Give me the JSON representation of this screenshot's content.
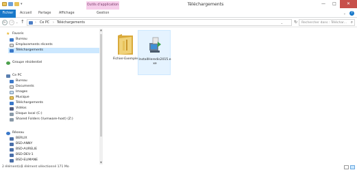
{
  "window": {
    "title": "Téléchargements",
    "contextual_tab": "Outils d'application",
    "minimize": "—",
    "maximize": "□",
    "close": "✕"
  },
  "ribbon": {
    "tabs": [
      "Fichier",
      "Accueil",
      "Partage",
      "Affichage",
      "Gestion"
    ],
    "collapse_chevron": "⌄",
    "help": "?"
  },
  "address": {
    "back": "←",
    "forward": "→",
    "history_dropdown": "⌄",
    "up": "↑",
    "crumbs": [
      "Ce PC",
      "Téléchargements"
    ],
    "separator": "›",
    "dropdown": "⌄",
    "refresh": "↻"
  },
  "search": {
    "placeholder": "Rechercher dans : Téléchar...",
    "icon": "⌕"
  },
  "nav": {
    "favorites": "Favoris",
    "fav_items": [
      "Bureau",
      "Emplacements récents",
      "Téléchargements"
    ],
    "homegroup": "Groupe résidentiel",
    "thispc": "Ce PC",
    "pc_items": [
      "Bureau",
      "Documents",
      "Images",
      "Musique",
      "Téléchargements",
      "Vidéos",
      "Disque local (C:)",
      "Shared Folders (\\\\vmware-host) (Z:)"
    ],
    "network": "Réseau",
    "net_items": [
      "BERLIX",
      "BSD-ANNY",
      "BSD-AURELIE",
      "BSD-DEV-1",
      "BSD-ELIMANE"
    ]
  },
  "files": [
    {
      "name": "Fichier-Exemple",
      "icon": "folder-icon"
    },
    {
      "name": "InstallHeredis2015.exe",
      "icon": "installer-icon"
    }
  ],
  "status": {
    "count": "2 élément(s)",
    "selection": "1 élément sélectionné  171 Mo"
  },
  "colors": {
    "file_tab": "#1979ca",
    "contextual_tab": "#f6cdea",
    "close_button": "#c7504b",
    "selection": "#cce8ff",
    "folder": "#e8c25a"
  }
}
